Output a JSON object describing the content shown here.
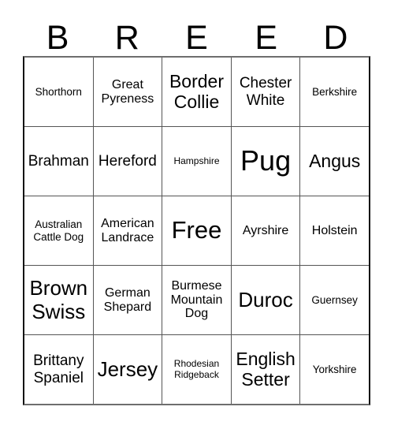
{
  "card": {
    "title_letters": [
      "B",
      "R",
      "E",
      "E",
      "D"
    ],
    "colors": {
      "background": "#ffffff",
      "text": "#000000",
      "grid_border": "#555555",
      "outer_border": "#111111"
    },
    "rows": [
      [
        {
          "label": "Shorthorn",
          "size": "sm"
        },
        {
          "label": "Great Pyreness",
          "size": "md"
        },
        {
          "label": "Border Collie",
          "size": "xl"
        },
        {
          "label": "Chester White",
          "size": "lg"
        },
        {
          "label": "Berkshire",
          "size": "sm"
        }
      ],
      [
        {
          "label": "Brahman",
          "size": "lg"
        },
        {
          "label": "Hereford",
          "size": "lg"
        },
        {
          "label": "Hampshire",
          "size": "xs"
        },
        {
          "label": "Pug",
          "size": "4xl"
        },
        {
          "label": "Angus",
          "size": "xl"
        }
      ],
      [
        {
          "label": "Australian Cattle Dog",
          "size": "sm"
        },
        {
          "label": "American Landrace",
          "size": "md"
        },
        {
          "label": "Free",
          "size": "3xl"
        },
        {
          "label": "Ayrshire",
          "size": "md"
        },
        {
          "label": "Holstein",
          "size": "md"
        }
      ],
      [
        {
          "label": "Brown Swiss",
          "size": "xxl"
        },
        {
          "label": "German Shepard",
          "size": "md"
        },
        {
          "label": "Burmese Mountain Dog",
          "size": "md"
        },
        {
          "label": "Duroc",
          "size": "xxl"
        },
        {
          "label": "Guernsey",
          "size": "sm"
        }
      ],
      [
        {
          "label": "Brittany Spaniel",
          "size": "lg"
        },
        {
          "label": "Jersey",
          "size": "xxl"
        },
        {
          "label": "Rhodesian Ridgeback",
          "size": "xs"
        },
        {
          "label": "English Setter",
          "size": "xl"
        },
        {
          "label": "Yorkshire",
          "size": "sm"
        }
      ]
    ]
  }
}
